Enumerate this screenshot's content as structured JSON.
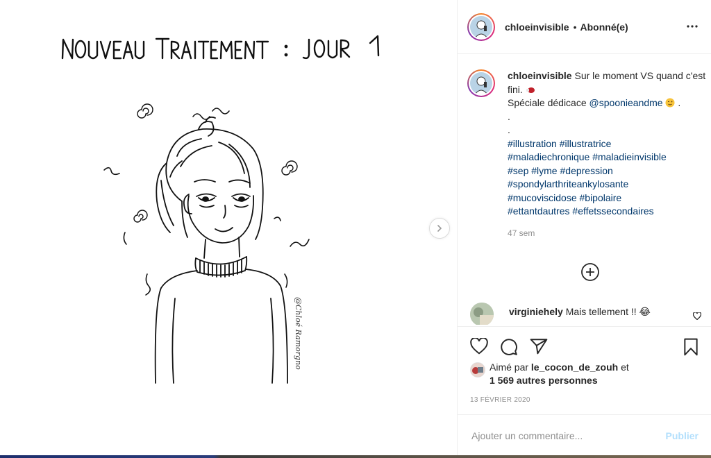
{
  "media": {
    "signature": "@Chloé Ramorgno"
  },
  "post_header": {
    "username": "chloeinvisible",
    "separator": "•",
    "follow_status": "Abonné(e)"
  },
  "caption": {
    "username": "chloeinvisible",
    "text_line1": " Sur le moment VS quand c'est fini. ",
    "text_line2": "Spéciale dédicace ",
    "mention": "@spoonieandme",
    "text_after_mention": " .",
    "dots": [
      ".",
      "."
    ],
    "hashtags": [
      "#illustration",
      "#illustratrice",
      "#maladiechronique",
      "#maladieinvisible",
      "#sep",
      "#lyme",
      "#depression",
      "#spondylarthriteankylosante",
      "#mucoviscidose",
      "#bipolaire",
      "#ettantdautres",
      "#effetssecondaires"
    ],
    "time_ago": "47 sem"
  },
  "comments": [
    {
      "username": "virginiehely",
      "text": " Mais tellement !! 😂"
    }
  ],
  "likes": {
    "prefix": "Aimé par ",
    "first_liker": "le_cocon_de_zouh",
    "conjunction": " et",
    "others": "1 569 autres personnes"
  },
  "date": "13 FÉVRIER 2020",
  "comment_box": {
    "placeholder": "Ajouter un commentaire...",
    "publish_label": "Publier"
  },
  "colors": {
    "link": "#00376b",
    "muted": "#8e8e8e",
    "publish_disabled": "#b2dffc"
  }
}
